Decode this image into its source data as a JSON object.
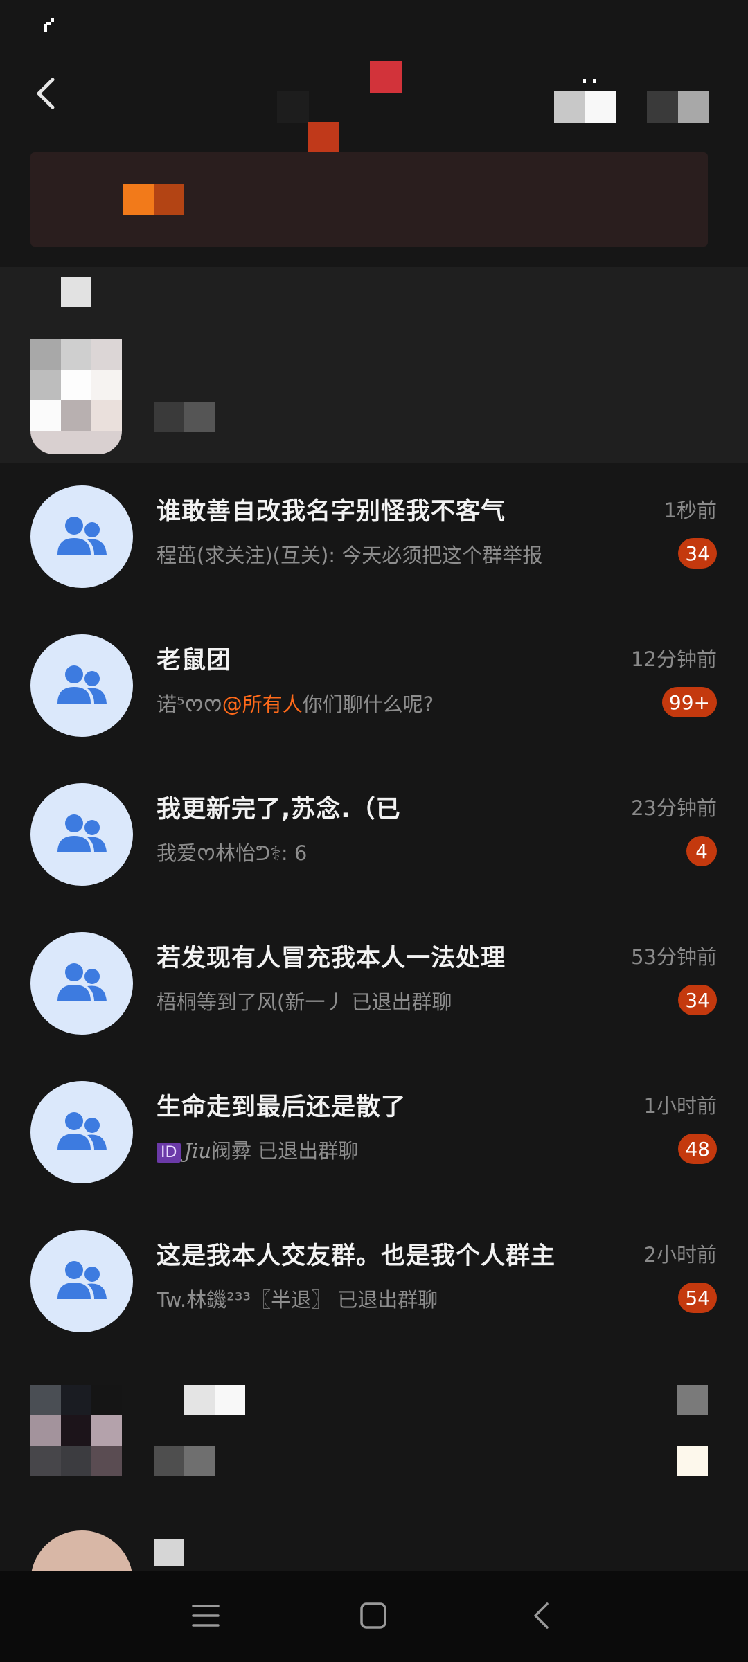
{
  "status_bar": {
    "icon": "signal-icon"
  },
  "header": {
    "back_icon": "back-arrow-icon"
  },
  "chats": [
    {
      "title": "谁敢善自改我名字别怪我不客气",
      "time": "1秒前",
      "preview_parts": [
        {
          "type": "text",
          "text": "程茁(求关注)(互关): 今天必须把这个群举报"
        }
      ],
      "badge": "34",
      "avatar_icon": "group-icon"
    },
    {
      "title": "老鼠团",
      "time": "12分钟前",
      "preview_parts": [
        {
          "type": "text",
          "text": "诺⁵ᰔ"
        },
        {
          "type": "text",
          "text": "ᰔ"
        },
        {
          "type": "mention",
          "text": "@所有人"
        },
        {
          "type": "text",
          "text": "你们聊什么呢?"
        }
      ],
      "badge": "99+",
      "avatar_icon": "group-icon"
    },
    {
      "title": "我更新完了,苏念.（已",
      "time": "23分钟前",
      "preview_parts": [
        {
          "type": "text",
          "text": "我爱ᰔ林怡ᕤ⚕: 6"
        }
      ],
      "badge": "4",
      "avatar_icon": "group-icon"
    },
    {
      "title": "若发现有人冒充我本人一法处理",
      "time": "53分钟前",
      "preview_parts": [
        {
          "type": "text",
          "text": "梧桐等到了风(新一丿 已退出群聊"
        }
      ],
      "badge": "34",
      "avatar_icon": "group-icon"
    },
    {
      "title": "生命走到最后还是散了",
      "time": "1小时前",
      "preview_parts": [
        {
          "type": "idtag",
          "text": "ID"
        },
        {
          "type": "script",
          "text": "Jiu"
        },
        {
          "type": "text",
          "text": "阀彛 已退出群聊"
        }
      ],
      "badge": "48",
      "avatar_icon": "group-icon"
    },
    {
      "title": "这是我本人交友群。也是我个人群主",
      "time": "2小时前",
      "preview_parts": [
        {
          "type": "text",
          "text": "Tw.林鐖²³³〖半退〗 已退出群聊"
        }
      ],
      "badge": "54",
      "avatar_icon": "group-icon"
    }
  ],
  "colors": {
    "badge": "#c4390e",
    "mention": "#ff6a1a",
    "avatar_bg": "#dbe8fb",
    "avatar_icon": "#3d7be0"
  },
  "nav": {
    "menu_icon": "menu-icon",
    "home_icon": "home-icon",
    "back_icon": "nav-back-icon"
  }
}
